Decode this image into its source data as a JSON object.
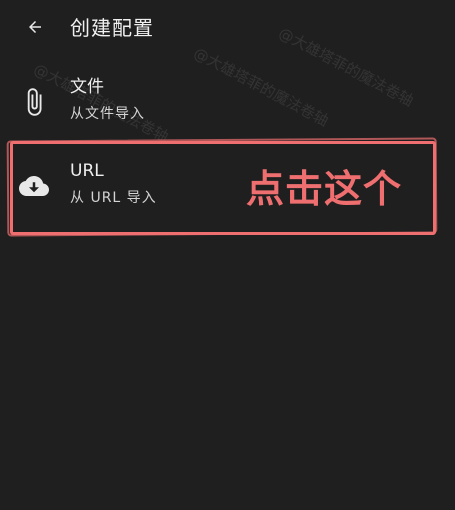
{
  "header": {
    "title": "创建配置",
    "back_icon": "arrow-left-icon"
  },
  "items": [
    {
      "title": "文件",
      "subtitle": "从文件导入",
      "icon": "paperclip-icon"
    },
    {
      "title": "URL",
      "subtitle": "从 URL 导入",
      "icon": "cloud-download-icon"
    }
  ],
  "annotation": {
    "text": "点击这个",
    "color": "#ef6f70"
  },
  "watermark": {
    "text": "@大雄塔菲的魔法卷轴"
  },
  "colors": {
    "background": "#1f1f1f",
    "text": "#eeeeee",
    "accent": "#ef6f70"
  }
}
